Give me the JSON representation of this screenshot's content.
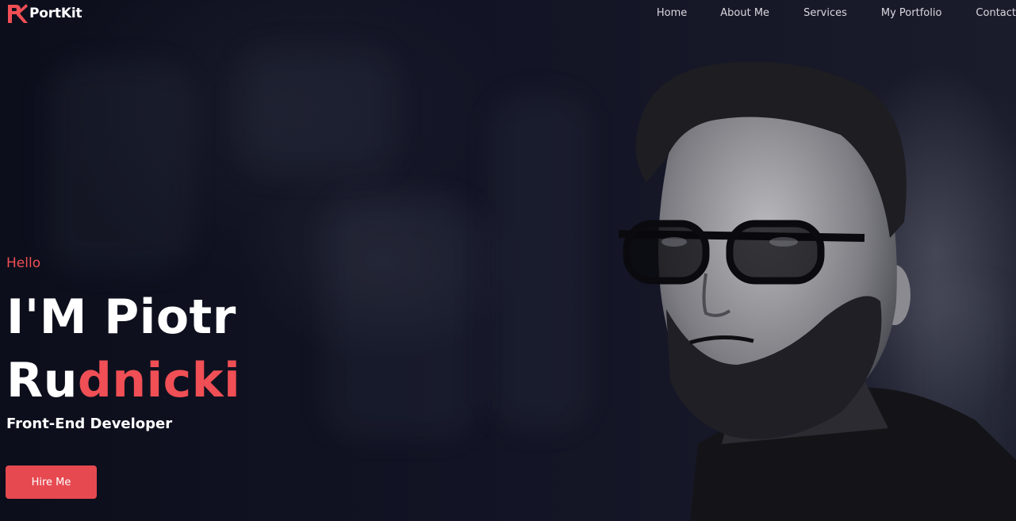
{
  "brand": {
    "name": "PortKit",
    "accent_color": "#ef4f55",
    "logo_icon": "pk-logo-icon"
  },
  "nav": {
    "items": [
      {
        "label": "Home"
      },
      {
        "label": "About Me"
      },
      {
        "label": "Services"
      },
      {
        "label": "My Portfolio"
      },
      {
        "label": "Contact"
      }
    ]
  },
  "hero": {
    "greeting": "Hello",
    "name_line1": "I'M Piotr",
    "name_line2_plain": "Ru",
    "name_line2_accent": "dnicki",
    "role": "Front-End Developer",
    "cta_label": "Hire Me",
    "cta_color": "#e64950",
    "background_color": "#0d0f1c"
  }
}
